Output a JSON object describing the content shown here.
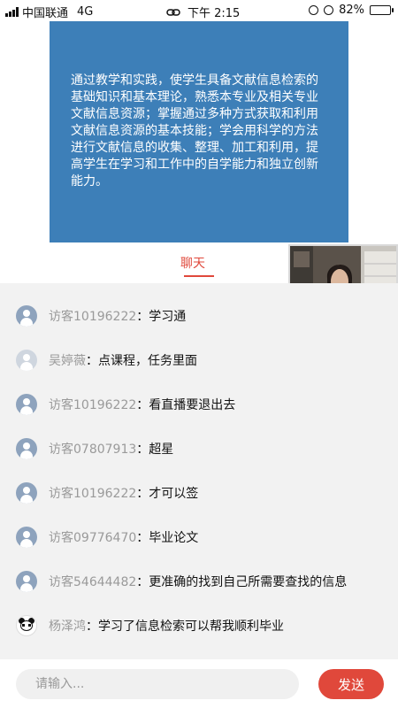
{
  "status_bar": {
    "carrier": "中国联通",
    "network": "4G",
    "time": "下午 2:15",
    "battery": "82%",
    "battery_level": 0.82
  },
  "slide": {
    "text": "通过教学和实践，使学生具备文献信息检索的基础知识和基本理论，熟悉本专业及相关专业文献信息资源；掌握通过多种方式获取和利用文献信息资源的基本技能；学会用科学的方法进行文献信息的收集、整理、加工和利用，提高学生在学习和工作中的自学能力和独立创新能力。",
    "color": "#3d7fb8"
  },
  "tabs": {
    "chat_label": "聊天",
    "accent_color": "#e0483b"
  },
  "messages": [
    {
      "avatar": "user-icon",
      "name": "访客10196222",
      "text": "学习通"
    },
    {
      "avatar": "user-icon-light",
      "name": "吴婷薇",
      "text": "点课程，任务里面"
    },
    {
      "avatar": "user-icon",
      "name": "访客10196222",
      "text": "看直播要退出去"
    },
    {
      "avatar": "user-icon",
      "name": "访客07807913",
      "text": "超星"
    },
    {
      "avatar": "user-icon",
      "name": "访客10196222",
      "text": "才可以签"
    },
    {
      "avatar": "user-icon",
      "name": "访客09776470",
      "text": "毕业论文"
    },
    {
      "avatar": "user-icon",
      "name": "访客54644482",
      "text": "更准确的找到自己所需要查找的信息"
    },
    {
      "avatar": "panda-avatar",
      "name": "杨泽鸿",
      "text": "学习了信息检索可以帮我顺利毕业"
    }
  ],
  "colon": "：",
  "input": {
    "placeholder": "请输入...",
    "value": "",
    "send_label": "发送"
  }
}
